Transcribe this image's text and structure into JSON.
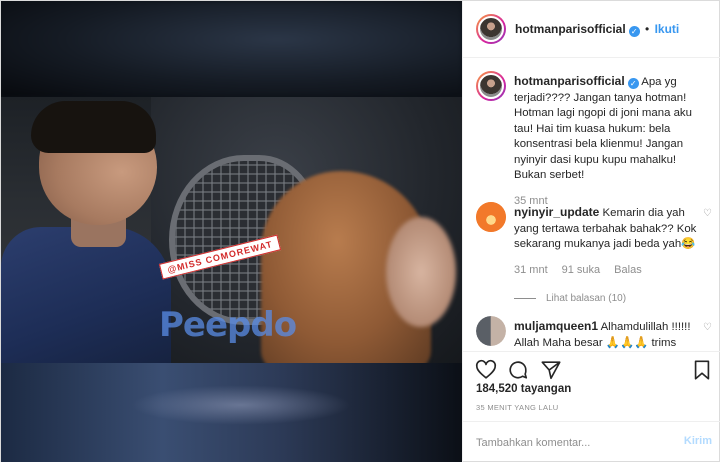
{
  "video": {
    "caption": "@MISS COMOREWAT",
    "watermark": "Peepdo"
  },
  "header": {
    "username": "hotmanparisofficial",
    "separator": "•",
    "follow_label": "Ikuti"
  },
  "post_caption": {
    "username": "hotmanparisofficial",
    "text": "Apa yg terjadi???? Jangan tanya hotman! Hotman lagi ngopi di joni mana aku tau! Hai tim kuasa hukum: bela konsentrasi bela klienmu! Jangan nyinyir dasi kupu kupu mahalku! Bukan serbet!",
    "time": "35 mnt"
  },
  "comments": [
    {
      "username": "nyinyir_update",
      "text": "Kemarin dia yah yang tertawa terbahak bahak?? Kok sekarang mukanya jadi beda yah😂",
      "time": "31 mnt",
      "likes": "91 suka",
      "reply_label": "Balas",
      "view_replies": "Lihat balasan (10)"
    },
    {
      "username": "muljamqueen1",
      "text": "Alhamdulillah !!!!!! Allah Maha besar 🙏🙏🙏 trims"
    }
  ],
  "actions": {
    "views": "184,520 tayangan",
    "timestamp": "35 MENIT YANG LALU"
  },
  "add_comment": {
    "placeholder": "Tambahkan komentar...",
    "send_label": "Kirim"
  },
  "colors": {
    "accent": "#3897f0",
    "muted": "#8e8e8e",
    "text": "#262626",
    "send_disabled": "#b3dbff"
  }
}
